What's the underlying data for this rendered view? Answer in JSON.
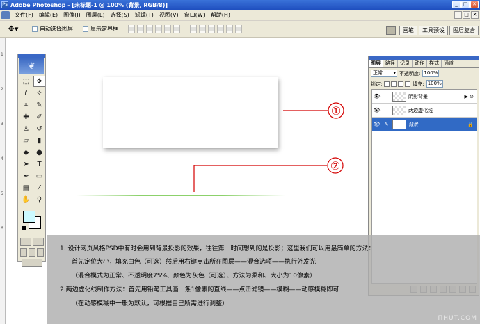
{
  "window": {
    "title": "Adobe Photoshop - [未标题-1 @ 100% (背景, RGB/8)]"
  },
  "menu": [
    "文件(F)",
    "编辑(E)",
    "图像(I)",
    "图层(L)",
    "选择(S)",
    "滤镜(T)",
    "视图(V)",
    "窗口(W)",
    "帮助(H)"
  ],
  "options": {
    "auto_select": "自动选择图层",
    "show_bounds": "显示定界框"
  },
  "wells": [
    "画笔",
    "工具预设",
    "图层复合"
  ],
  "layers_panel": {
    "tabs": [
      "图层",
      "路径",
      "记录",
      "动作",
      "样式",
      "通道"
    ],
    "blend_mode": "正常",
    "opacity_label": "不透明度:",
    "opacity": "100%",
    "lock_label": "锁定:",
    "fill_label": "填充:",
    "fill": "100%",
    "layers": [
      {
        "name": "阴影背景",
        "fx": "▶ ⊘"
      },
      {
        "name": "两边虚化线",
        "fx": ""
      },
      {
        "name": "背景",
        "fx": "🔒"
      }
    ]
  },
  "callouts": [
    "①",
    "②"
  ],
  "instructions": [
    "1. 设计网页风格PSD中有时会用到背景投影的效果，往往第一时间想到的是投影；这里我们可以用最简单的方法：",
    "首先定位大小，填充白色（可选）然后用右键点击所在图层——混合选项——执行外发光",
    "（混合模式为正常、不透明度75%、颜色为灰色（可选）、方法为柔和、大小为10像素）",
    "2.两边虚化线制作方法：首先用铅笔工具画一条1像素的直线——点击滤镜——模糊——动感模糊即可",
    "（在动感模糊中一般为默认，可根据自己所需进行调整）"
  ],
  "watermark": "ПHUT.COM"
}
